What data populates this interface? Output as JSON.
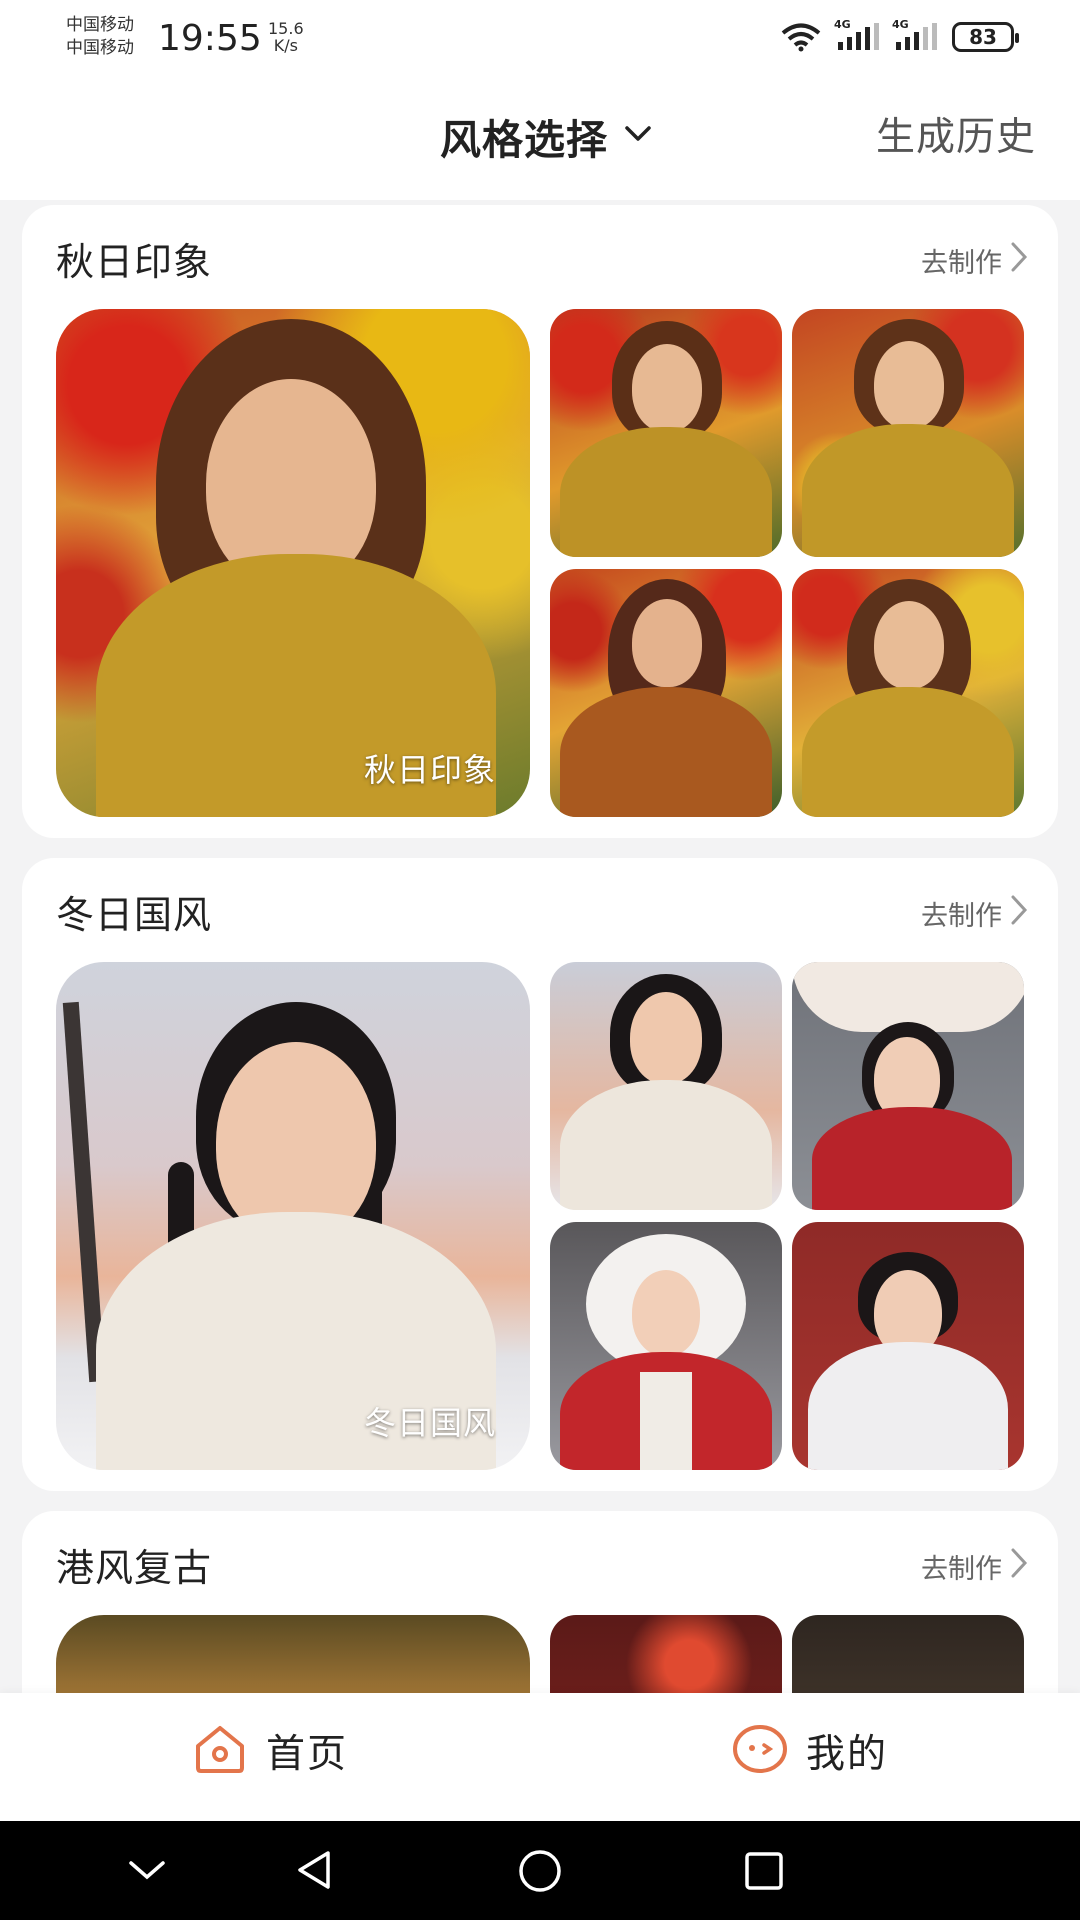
{
  "status_bar": {
    "carrier_1": "中国移动",
    "carrier_2": "中国移动",
    "time": "19:55",
    "speed_value": "15.6",
    "speed_unit": "K/s",
    "signal_1_label": "4G",
    "signal_2_label": "4G",
    "battery": "83"
  },
  "header": {
    "title": "风格选择",
    "history_link": "生成历史"
  },
  "cards": [
    {
      "title": "秋日印象",
      "action": "去制作",
      "feature_label": "秋日印象"
    },
    {
      "title": "冬日国风",
      "action": "去制作",
      "feature_label": "冬日国风"
    },
    {
      "title": "港风复古",
      "action": "去制作"
    }
  ],
  "bottom_nav": {
    "home": "首页",
    "mine": "我的"
  },
  "colors": {
    "accent": "#e3754b",
    "card_bg": "#ffffff",
    "page_bg": "#f3f3f4"
  }
}
